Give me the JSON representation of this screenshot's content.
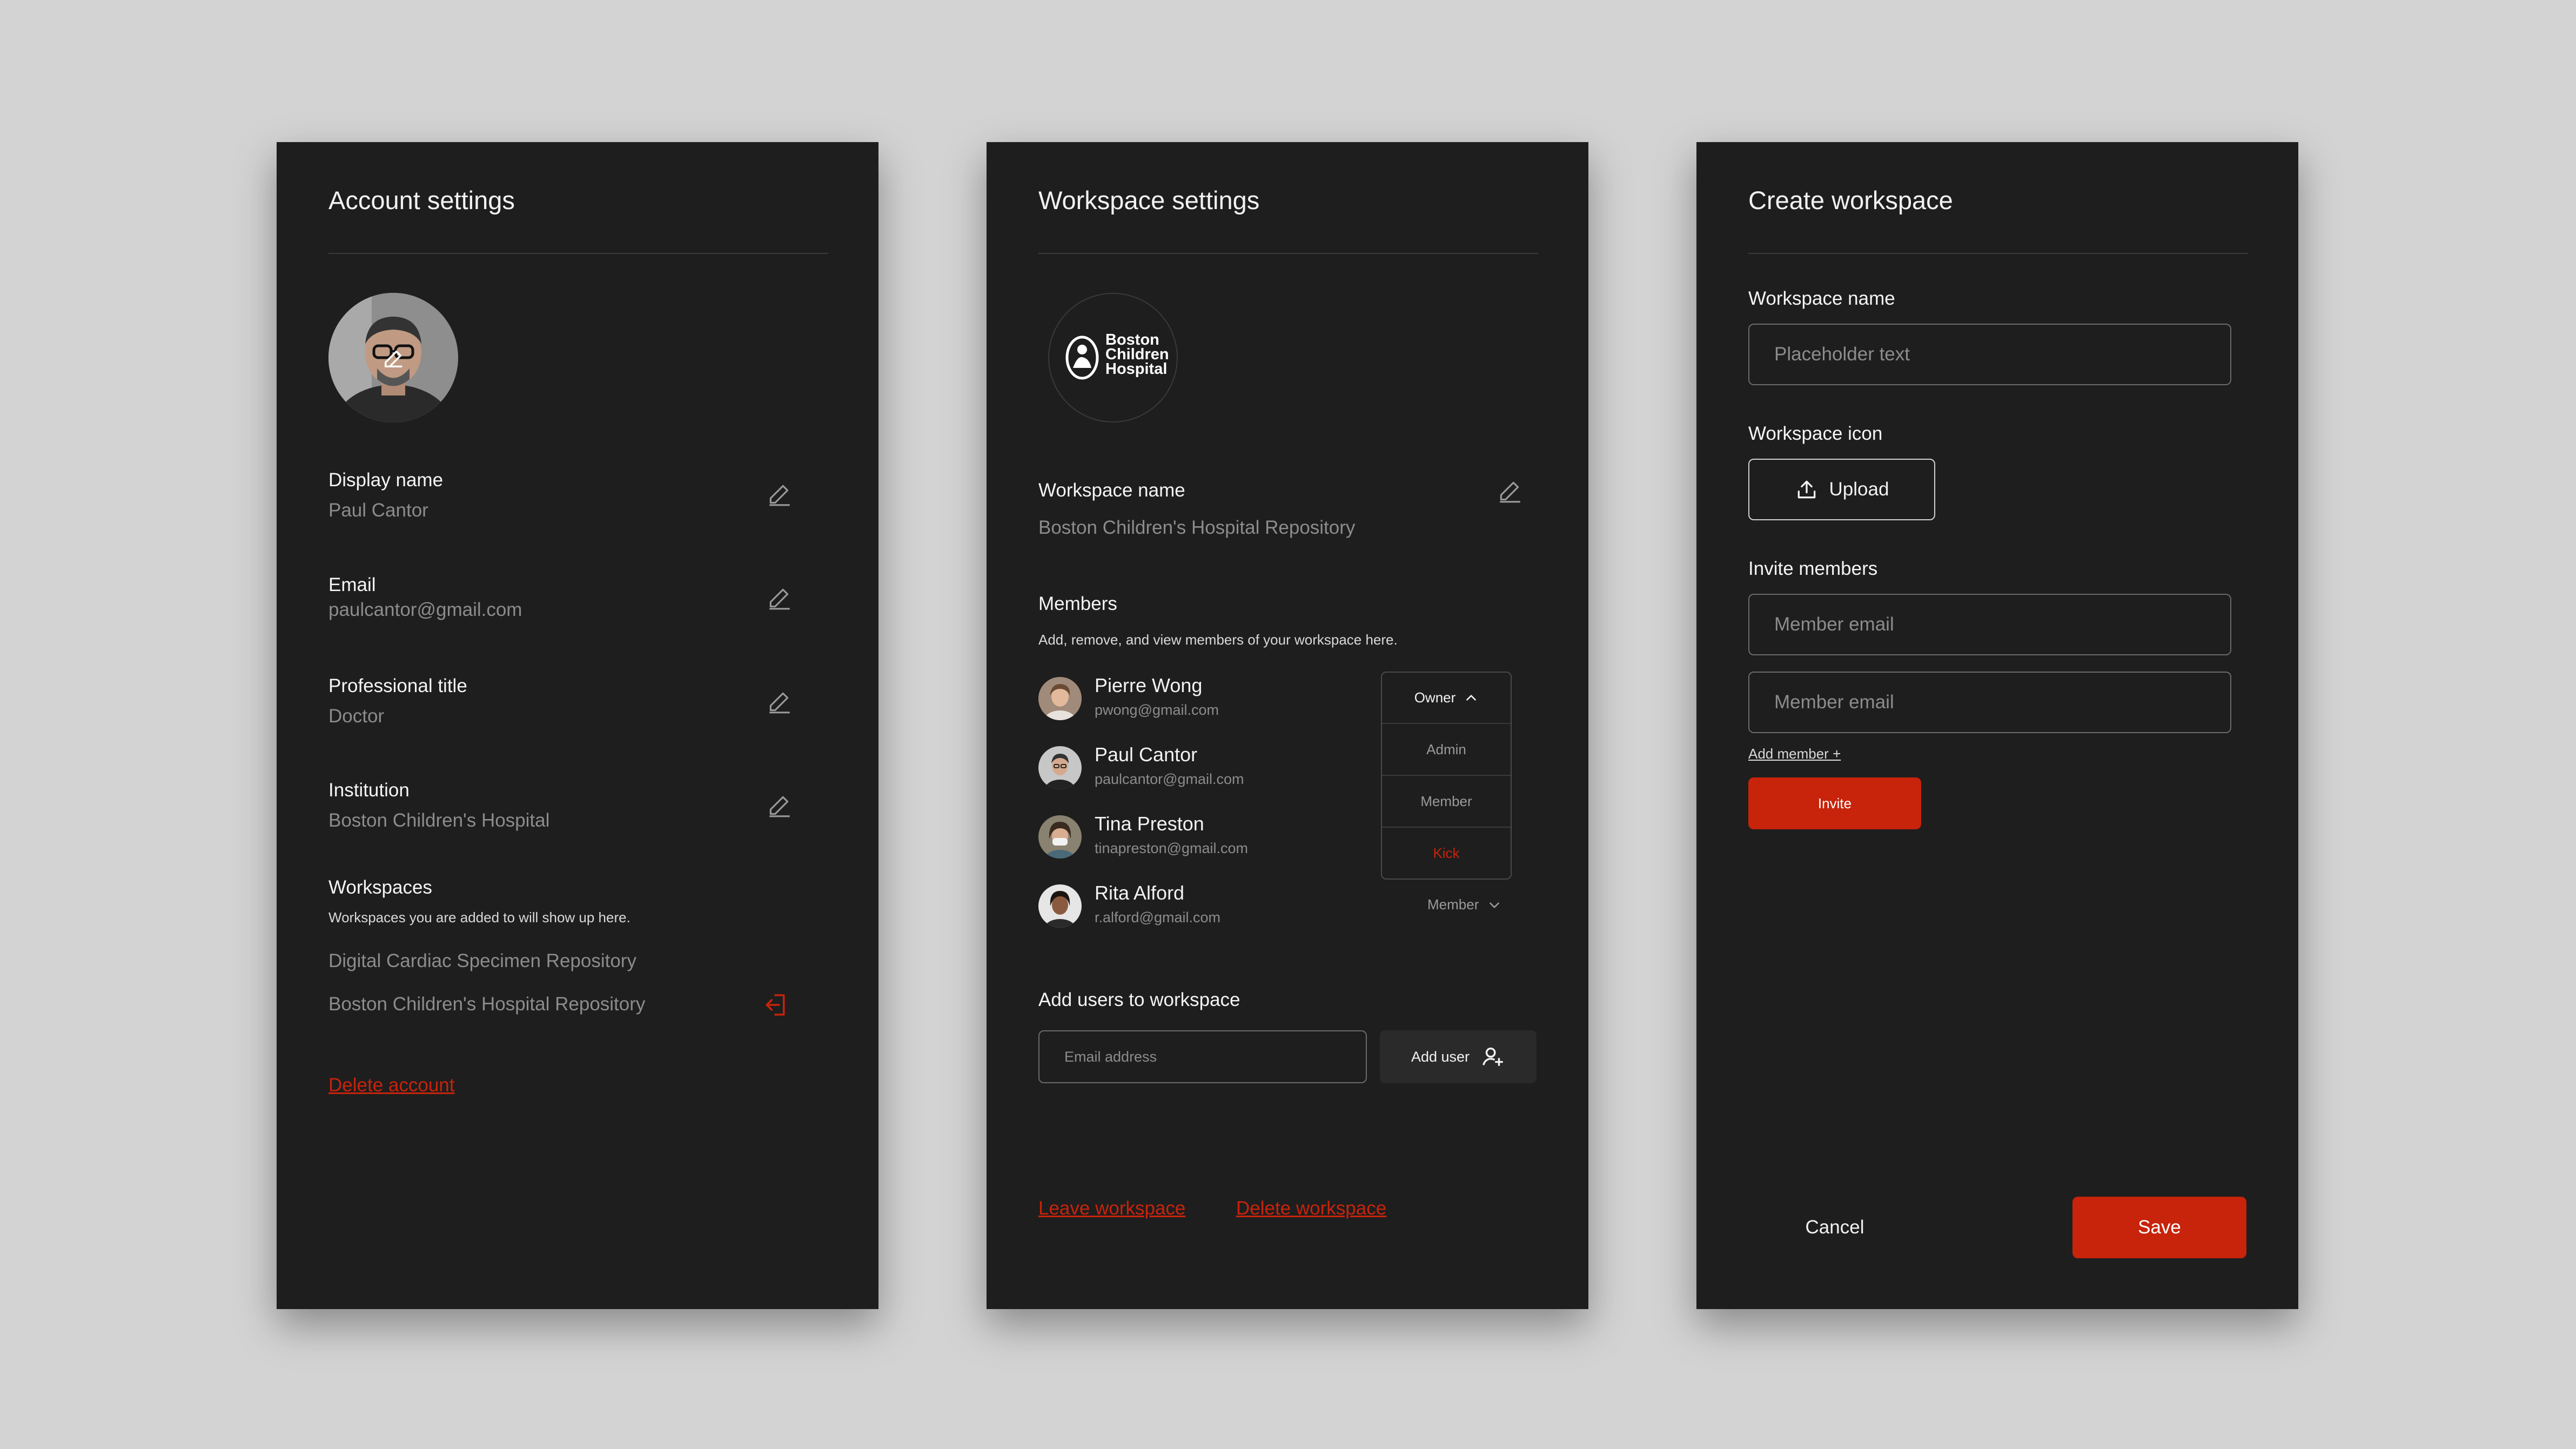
{
  "account": {
    "title": "Account settings",
    "fields": [
      {
        "label": "Display name",
        "value": "Paul Cantor"
      },
      {
        "label": "Email",
        "value": "paulcantor@gmail.com"
      },
      {
        "label": "Professional title",
        "value": "Doctor"
      },
      {
        "label": "Institution",
        "value": "Boston Children's Hospital"
      }
    ],
    "workspaces_label": "Workspaces",
    "workspaces_desc": "Workspaces you are added to will show up here.",
    "workspaces": [
      "Digital Cardiac Specimen Repository",
      "Boston Children's Hospital Repository"
    ],
    "delete_account": "Delete account"
  },
  "workspace": {
    "title": "Workspace settings",
    "logo_lines": [
      "Boston",
      "Children",
      "Hospital"
    ],
    "name_label": "Workspace name",
    "name_value": "Boston Children's Hospital Repository",
    "members_label": "Members",
    "members_desc": "Add, remove, and view members of your workspace here.",
    "members": [
      {
        "name": "Pierre Wong",
        "email": "pwong@gmail.com"
      },
      {
        "name": "Paul Cantor",
        "email": "paulcantor@gmail.com"
      },
      {
        "name": "Tina Preston",
        "email": "tinapreston@gmail.com"
      },
      {
        "name": "Rita Alford",
        "email": "r.alford@gmail.com"
      }
    ],
    "role_dropdown": {
      "selected": "Owner",
      "options": [
        "Admin",
        "Member",
        "Kick"
      ]
    },
    "rita_role": "Member",
    "add_users_label": "Add users to workspace",
    "email_placeholder": "Email address",
    "add_user_button": "Add user",
    "leave": "Leave workspace",
    "delete": "Delete workspace"
  },
  "create": {
    "title": "Create workspace",
    "name_label": "Workspace name",
    "name_placeholder": "Placeholder text",
    "icon_label": "Workspace icon",
    "upload": "Upload",
    "invite_label": "Invite members",
    "member_placeholder": "Member email",
    "add_member": "Add member +",
    "invite": "Invite",
    "cancel": "Cancel",
    "save": "Save"
  },
  "colors": {
    "accent": "#c8230b",
    "panel": "#1e1e1e",
    "background": "#d3d3d3"
  }
}
